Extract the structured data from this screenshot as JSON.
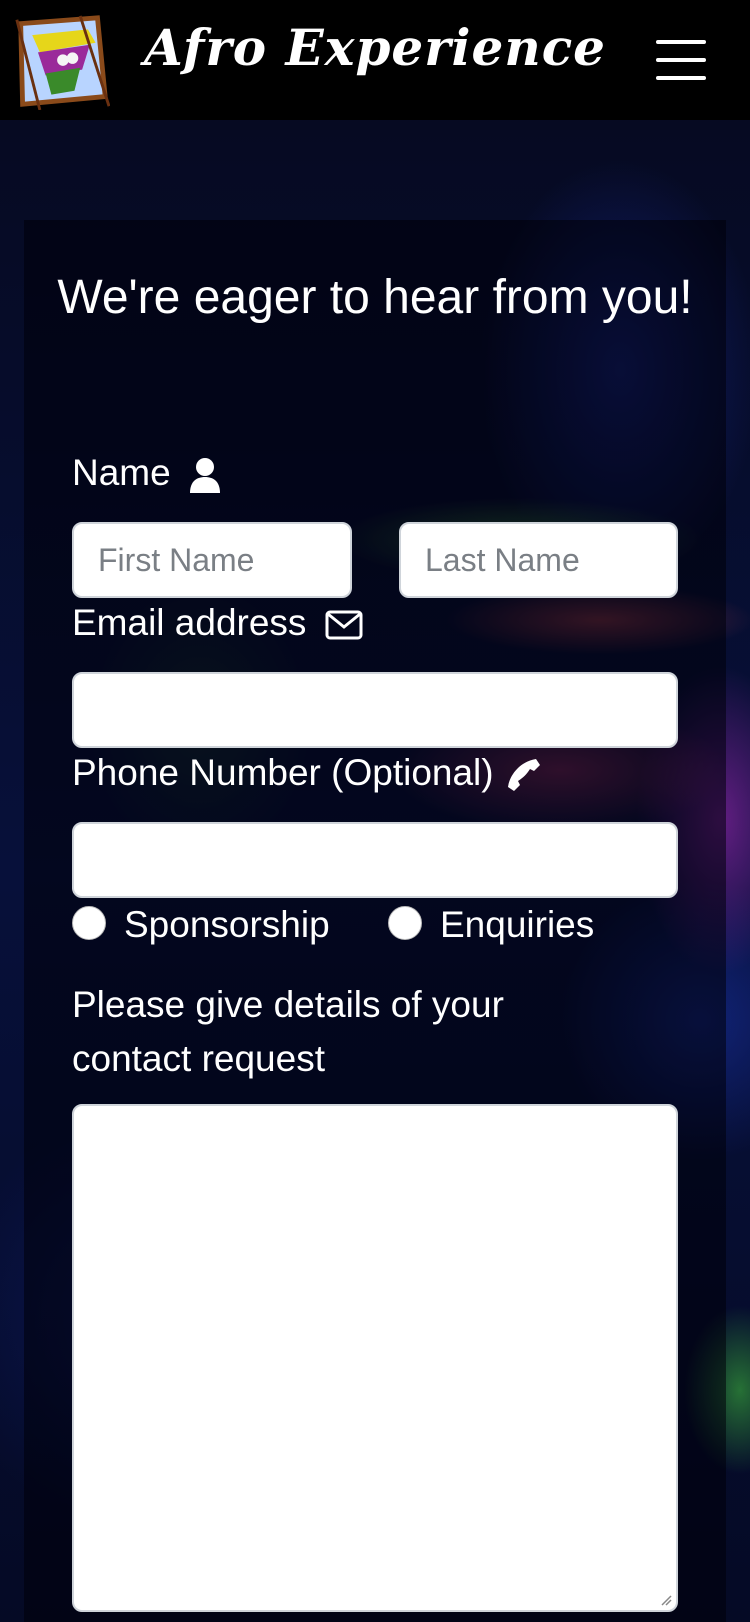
{
  "navbar": {
    "brand": "Afro Experience"
  },
  "form": {
    "heading": "We're eager to hear from you!",
    "name_label": "Name",
    "first_name_placeholder": "First Name",
    "last_name_placeholder": "Last Name",
    "email_label": "Email address",
    "email_value": "",
    "phone_label": "Phone Number (Optional)",
    "phone_value": "",
    "radio_options": [
      "Sponsorship",
      "Enquiries"
    ],
    "details_label": "Please give details of your contact request",
    "details_value": ""
  },
  "icons": {
    "name": "user-icon",
    "email": "envelope-icon",
    "phone": "phone-icon",
    "menu": "hamburger-menu-icon"
  }
}
